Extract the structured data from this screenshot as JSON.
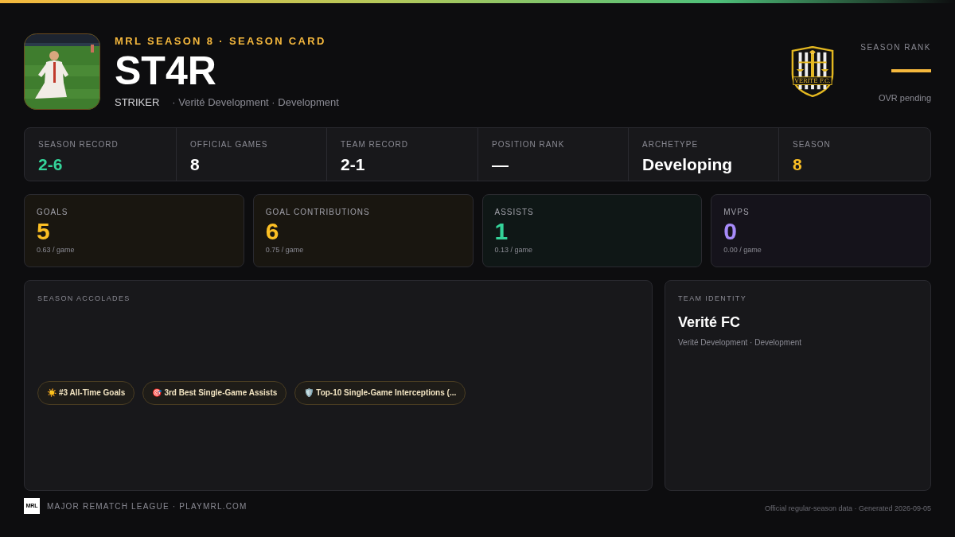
{
  "header": {
    "eyebrow": "MRL SEASON 8 · SEASON CARD",
    "player_name": "ST4R",
    "position": "STRIKER",
    "team_line": "· Verité Development · Development",
    "crest_text": "VERITE F.C.",
    "rank_label": "SEASON RANK",
    "rank_note": "OVR pending"
  },
  "summary": [
    {
      "label": "SEASON RECORD",
      "value": "2-6",
      "color": "#34d399"
    },
    {
      "label": "OFFICIAL GAMES",
      "value": "8",
      "color": "#ffffff"
    },
    {
      "label": "TEAM RECORD",
      "value": "2-1",
      "color": "#ffffff"
    },
    {
      "label": "POSITION RANK",
      "value": "—",
      "color": "#ffffff"
    },
    {
      "label": "ARCHETYPE",
      "value": "Developing",
      "color": "#ffffff"
    },
    {
      "label": "SEASON",
      "value": "8",
      "color": "#fbbf24"
    }
  ],
  "stat_cards": [
    {
      "label": "GOALS",
      "value": "5",
      "per_game": "0.63 / game",
      "color": "#fbbf24"
    },
    {
      "label": "GOAL CONTRIBUTIONS",
      "value": "6",
      "per_game": "0.75 / game",
      "color": "#fbbf24"
    },
    {
      "label": "ASSISTS",
      "value": "1",
      "per_game": "0.13 / game",
      "color": "#34d399"
    },
    {
      "label": "MVPS",
      "value": "0",
      "per_game": "0.00 / game",
      "color": "#a78bfa"
    }
  ],
  "accolades": {
    "title": "SEASON ACCOLADES",
    "items": [
      {
        "icon": "☀️",
        "label": "#3 All-Time Goals"
      },
      {
        "icon": "🎯",
        "label": "3rd Best Single-Game Assists"
      },
      {
        "icon": "🛡️",
        "label": "Top-10 Single-Game Interceptions (..."
      }
    ]
  },
  "team_identity": {
    "title": "TEAM IDENTITY",
    "name": "Verité FC",
    "subtitle": "Verité Development · Development"
  },
  "footer": {
    "logo_text": "MRL",
    "league": "MAJOR REMATCH LEAGUE · PLAYMRL.COM",
    "note": "Official regular-season data · Generated 2026-09-05"
  }
}
